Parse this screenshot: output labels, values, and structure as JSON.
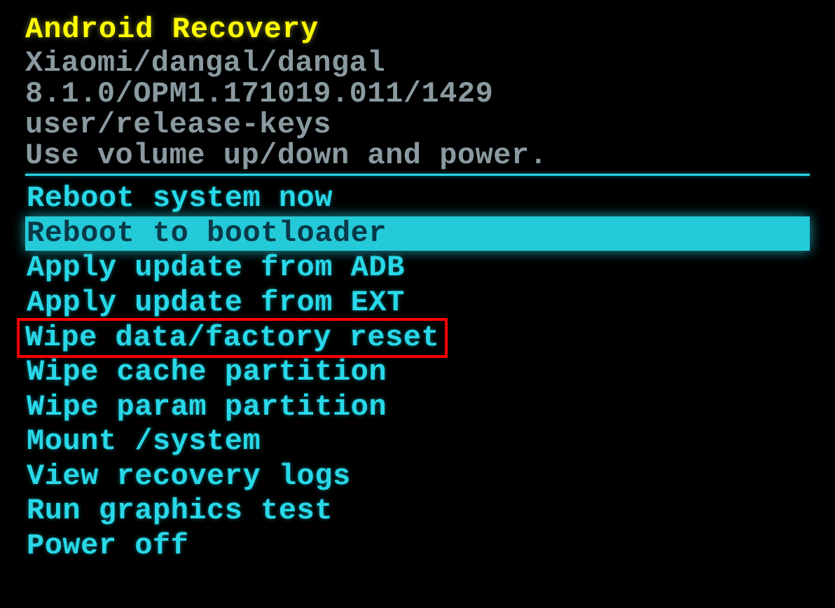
{
  "header": {
    "title": "Android Recovery",
    "device": "Xiaomi/dangal/dangal",
    "build": "8.1.0/OPM1.171019.011/1429",
    "keys": "user/release-keys",
    "instructions": "Use volume up/down and power."
  },
  "menu": {
    "items": [
      "Reboot system now",
      "Reboot to bootloader",
      "Apply update from ADB",
      "Apply update from EXT",
      "Wipe data/factory reset",
      "Wipe cache partition",
      "Wipe param partition",
      "Mount /system",
      "View recovery logs",
      "Run graphics test",
      "Power off"
    ],
    "selectedIndex": 1,
    "highlightedIndex": 4
  }
}
